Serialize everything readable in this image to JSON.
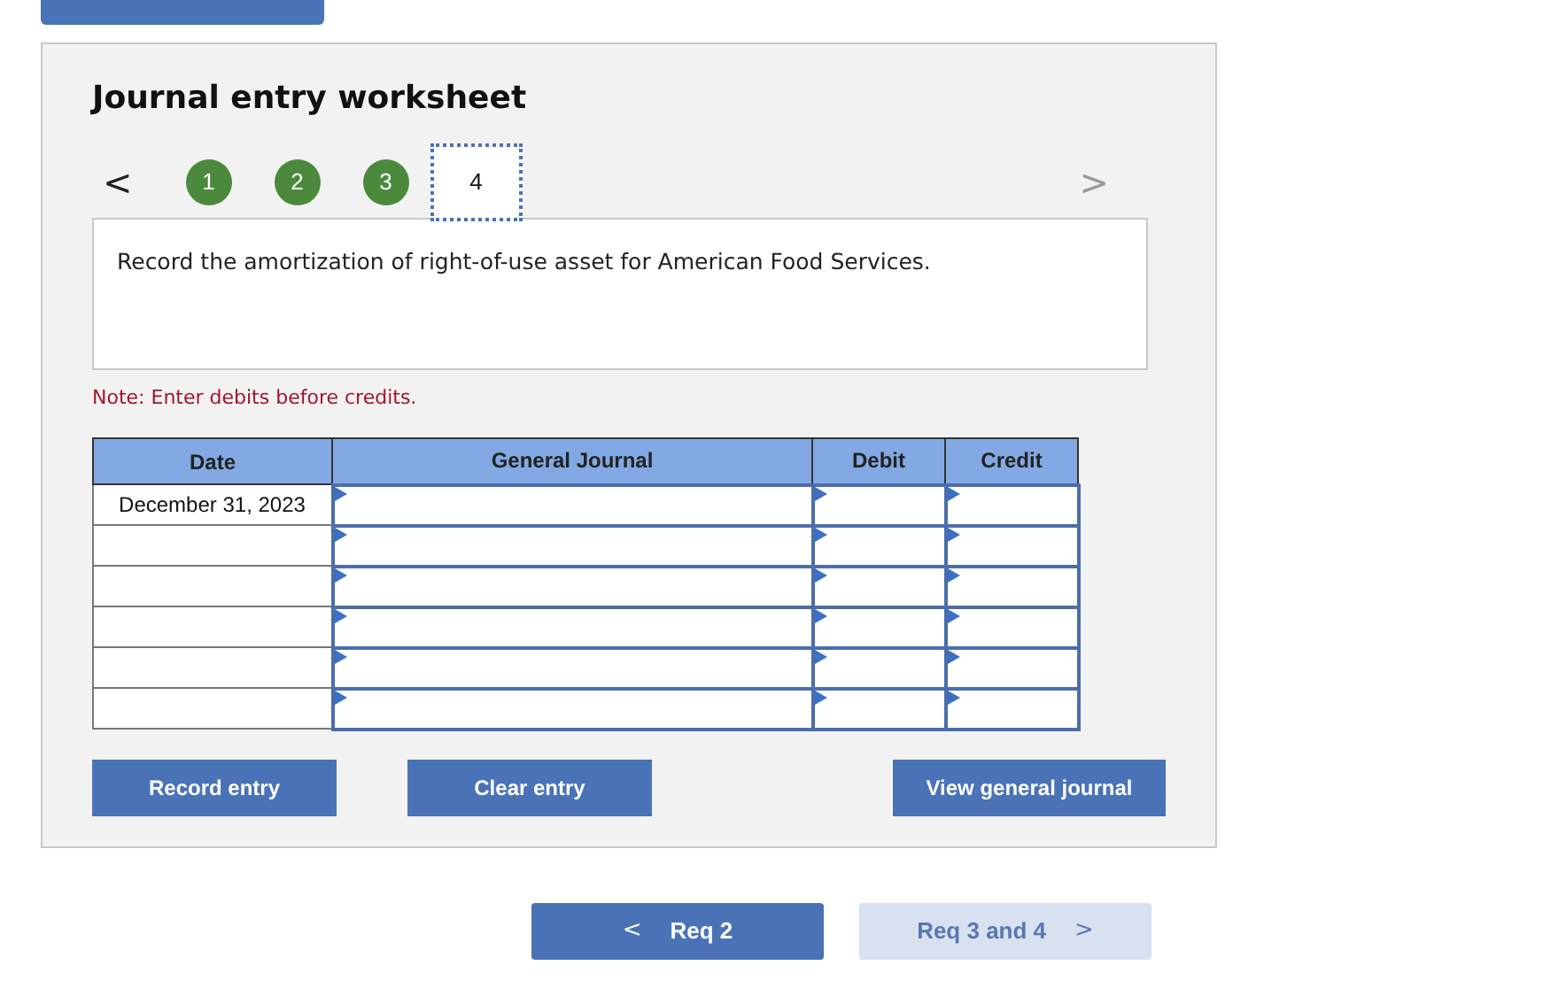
{
  "top_button": {
    "visible": true
  },
  "worksheet": {
    "title": "Journal entry worksheet",
    "prev_arrow": "<",
    "next_arrow": ">",
    "steps": [
      {
        "label": "1",
        "completed": true,
        "selected": false
      },
      {
        "label": "2",
        "completed": true,
        "selected": false
      },
      {
        "label": "3",
        "completed": true,
        "selected": false
      },
      {
        "label": "4",
        "completed": false,
        "selected": true
      }
    ],
    "prompt": "Record the amortization of right-of-use asset for American Food Services.",
    "note": "Note: Enter debits before credits.",
    "table": {
      "columns": [
        "Date",
        "General Journal",
        "Debit",
        "Credit"
      ],
      "rows": [
        {
          "date": "December 31, 2023"
        },
        {
          "date": ""
        },
        {
          "date": ""
        },
        {
          "date": ""
        },
        {
          "date": ""
        },
        {
          "date": ""
        }
      ]
    },
    "buttons": [
      "Record entry",
      "Clear entry",
      "View general journal"
    ]
  },
  "nav": [
    {
      "label": "Req 2",
      "arrow": "<",
      "kind": "prev",
      "disabled": false
    },
    {
      "label": "Req 3 and 4",
      "arrow": ">",
      "kind": "next",
      "disabled": true
    }
  ]
}
